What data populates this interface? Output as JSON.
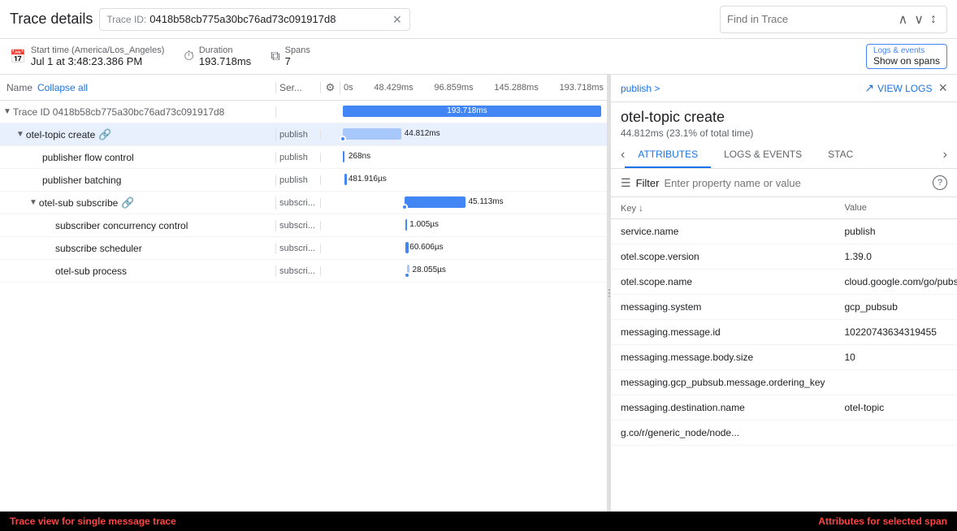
{
  "header": {
    "title": "Trace details",
    "trace_id_label": "Trace ID:",
    "trace_id_value": "0418b58cb775a30bc76ad73c091917d8",
    "find_placeholder": "Find in Trace",
    "clear_btn": "×"
  },
  "metadata": {
    "start_label": "Start time (America/Los_Angeles)",
    "start_value": "Jul 1 at 3:48:23.386 PM",
    "duration_label": "Duration",
    "duration_value": "193.718ms",
    "spans_label": "Spans",
    "spans_value": "7",
    "logs_events_title": "Logs & events",
    "logs_events_value": "Show on spans"
  },
  "trace_table": {
    "col_name": "Name",
    "col_collapse": "Collapse all",
    "col_service": "Ser...",
    "timeline_labels": [
      "0s",
      "48.429ms",
      "96.859ms",
      "145.288ms",
      "193.718ms"
    ],
    "rows": [
      {
        "id": "root",
        "indent": 0,
        "expanded": true,
        "name": "Trace ID 0418b58cb775a30bc76ad73c091917d8",
        "service": "",
        "bar_left_pct": 0,
        "bar_width_pct": 100,
        "bar_color": "blue",
        "label": "193.718ms",
        "label_inside": true
      },
      {
        "id": "otel-topic-create",
        "indent": 1,
        "expanded": true,
        "name": "otel-topic create",
        "has_link": true,
        "service": "publish",
        "bar_left_pct": 0,
        "bar_width_pct": 23.1,
        "bar_color": "light-blue",
        "label": "44.812ms",
        "has_dot": true,
        "selected": true
      },
      {
        "id": "publisher-flow",
        "indent": 3,
        "name": "publisher flow control",
        "service": "publish",
        "bar_left_pct": 0.01,
        "bar_width_pct": 0.2,
        "bar_color": "blue",
        "label": "268ns"
      },
      {
        "id": "publisher-batching",
        "indent": 3,
        "name": "publisher batching",
        "service": "publish",
        "bar_left_pct": 0.15,
        "bar_width_pct": 0.5,
        "bar_color": "blue",
        "label": "481.916µs"
      },
      {
        "id": "otel-sub-subscribe",
        "indent": 2,
        "expanded": true,
        "name": "otel-sub subscribe",
        "has_link": true,
        "service": "subscri...",
        "bar_left_pct": 23.2,
        "bar_width_pct": 23.3,
        "bar_color": "blue",
        "label": "45.113ms",
        "has_dot": true
      },
      {
        "id": "subscriber-concurrency",
        "indent": 4,
        "name": "subscriber concurrency control",
        "service": "subscri...",
        "bar_left_pct": 23.3,
        "bar_width_pct": 0.01,
        "bar_color": "blue",
        "label": "1.005µs"
      },
      {
        "id": "subscribe-scheduler",
        "indent": 4,
        "name": "subscribe scheduler",
        "service": "subscri...",
        "bar_left_pct": 23.3,
        "bar_width_pct": 0.4,
        "bar_color": "blue",
        "label": "60.606µs"
      },
      {
        "id": "otel-sub-process",
        "indent": 4,
        "name": "otel-sub process",
        "service": "subscri...",
        "bar_left_pct": 23.5,
        "bar_width_pct": 0.2,
        "bar_color": "light-blue",
        "label": "28.055µs",
        "has_dot": true
      }
    ]
  },
  "detail": {
    "breadcrumb": "publish >",
    "view_logs_label": "VIEW LOGS",
    "close_label": "×",
    "title": "otel-topic create",
    "subtitle": "44.812ms (23.1% of total time)",
    "tabs": [
      {
        "id": "attributes",
        "label": "ATTRIBUTES",
        "active": true
      },
      {
        "id": "logs-events",
        "label": "LOGS & EVENTS",
        "active": false
      },
      {
        "id": "stack",
        "label": "STAC",
        "active": false
      }
    ],
    "filter_placeholder": "Enter property name or value",
    "table": {
      "col_key": "Key",
      "col_value": "Value",
      "rows": [
        {
          "key": "service.name",
          "value": "publish"
        },
        {
          "key": "otel.scope.version",
          "value": "1.39.0"
        },
        {
          "key": "otel.scope.name",
          "value": "cloud.google.com/go/pubsub"
        },
        {
          "key": "messaging.system",
          "value": "gcp_pubsub"
        },
        {
          "key": "messaging.message.id",
          "value": "10220743634319455"
        },
        {
          "key": "messaging.message.body.size",
          "value": "10"
        },
        {
          "key": "messaging.gcp_pubsub.message.ordering_key",
          "value": ""
        },
        {
          "key": "messaging.destination.name",
          "value": "otel-topic"
        },
        {
          "key": "g.co/r/generic_node/node...",
          "value": ""
        }
      ]
    }
  },
  "annotation": {
    "left": "Trace view for single message trace",
    "right": "Attributes for selected span"
  }
}
